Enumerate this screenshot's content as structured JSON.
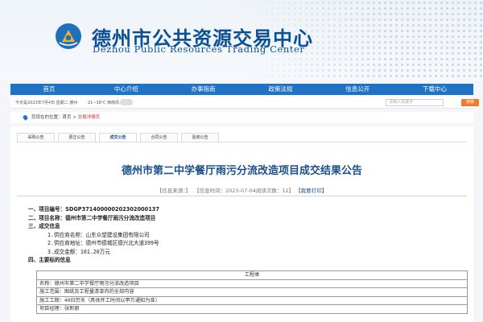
{
  "site": {
    "title": "德州市公共资源交易中心",
    "subtitle": "Dezhou Public Resources Trading Center"
  },
  "nav": [
    "首页",
    "中心介绍",
    "办事指南",
    "政策法规",
    "信息公开",
    "下载中心"
  ],
  "infobar": {
    "date": "今天是2023年7月4日  星期二  德州",
    "weather": "21~36℃  西南风",
    "search_placeholder": "请输入关键字",
    "search_button": "搜索"
  },
  "breadcrumb": {
    "prefix": "您现在的位置：",
    "home": "首页",
    "sep": " > ",
    "current": "交易详情页"
  },
  "tabs": [
    "采购公告",
    "更正公告",
    "成交公告",
    "合同公告",
    "验收公告"
  ],
  "active_tab": 2,
  "article": {
    "title": "德州市第二中学餐厅雨污分流改造项目成交结果公告",
    "meta_source": "【信息来源：】",
    "meta_time": "【信息时间：2023-07-04阅读次数：12】",
    "print": "【我要打印】",
    "lines": [
      "一、项目编号：SDGP371400000202302000137",
      "二、项目名称：德州市第二中学餐厅雨污分流改造项目",
      "三、成交信息",
      "1.供应商名称：山东众望建设集团有限公司",
      "2.供应商地址：德州市德城区德兴北大道399号",
      "3.成交金额：101.20万元",
      "四、主要标的信息"
    ],
    "table_header": "工程类",
    "table_rows": [
      "名称：德州市第二中学餐厅雨污分流改造项目",
      "施工范围：图纸及工程量清单内的全部内容",
      "施工工期：40日历天（具体开工时间以甲方通知为准）",
      "项目经理：张新丽"
    ]
  }
}
